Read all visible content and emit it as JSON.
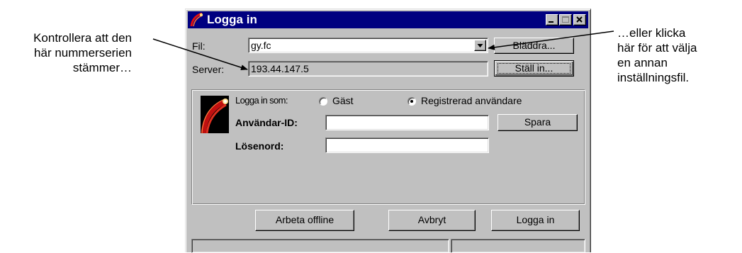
{
  "annotations": {
    "left": [
      "Kontrollera att den",
      "här nummerserien",
      "stämmer…"
    ],
    "right": [
      "…eller klicka",
      "här för att välja",
      "en annan",
      "inställningsfil."
    ]
  },
  "window": {
    "title": "Logga in",
    "icons": {
      "app": "comet-logo-icon",
      "minimize": "minimize-icon",
      "maximize": "maximize-icon",
      "close": "close-icon"
    }
  },
  "file": {
    "label": "Fil:",
    "value": "gy.fc",
    "browse_button": "Bläddra..."
  },
  "server": {
    "label": "Server:",
    "value": "193.44.147.5",
    "setup_button": "Ställ in..."
  },
  "login_as": {
    "label": "Logga in som:",
    "options": [
      {
        "label": "Gäst",
        "selected": false
      },
      {
        "label": "Registrerad användare",
        "selected": true
      }
    ]
  },
  "user_id": {
    "label": "Användar-ID:",
    "value": "",
    "save_button": "Spara"
  },
  "password": {
    "label": "Lösenord:",
    "value": ""
  },
  "footer_buttons": {
    "offline": "Arbeta offline",
    "cancel": "Avbryt",
    "login": "Logga in"
  },
  "status": {
    "left": "",
    "right": ""
  }
}
